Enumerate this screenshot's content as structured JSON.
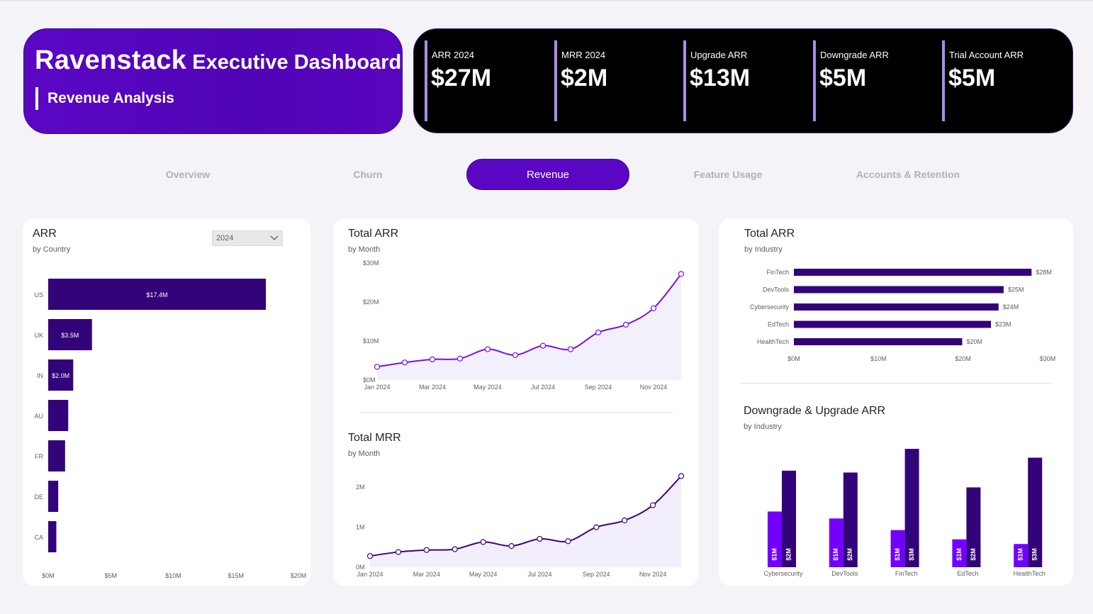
{
  "header": {
    "brand": "Ravenstack",
    "title_rest": "Executive Dashboard",
    "subtitle": "Revenue Analysis"
  },
  "kpis": [
    {
      "label": "ARR 2024",
      "value": "$27M"
    },
    {
      "label": "MRR 2024",
      "value": "$2M"
    },
    {
      "label": "Upgrade ARR",
      "value": "$13M"
    },
    {
      "label": "Downgrade ARR",
      "value": "$5M"
    },
    {
      "label": "Trial Account ARR",
      "value": "$5M"
    }
  ],
  "tabs": [
    {
      "label": "Overview",
      "active": false
    },
    {
      "label": "Churn",
      "active": false
    },
    {
      "label": "Revenue",
      "active": true
    },
    {
      "label": "Feature Usage",
      "active": false
    },
    {
      "label": "Accounts & Retention",
      "active": false
    }
  ],
  "filter": {
    "year": "2024",
    "icon": "chevron-down-icon"
  },
  "colors": {
    "accent": "#5a06c2",
    "bar_dark": "#33037a",
    "line_purple": "#7b10e8",
    "bar_bright": "#7200ff",
    "kpi_bar": "#a98de6"
  },
  "chart_data": [
    {
      "id": "arr_by_country",
      "type": "bar",
      "orientation": "horizontal",
      "title": "ARR",
      "subtitle": "by Country",
      "categories": [
        "US",
        "UK",
        "IN",
        "AU",
        "FR",
        "DE",
        "CA"
      ],
      "values": [
        17.4,
        3.5,
        2.0,
        1.6,
        1.35,
        0.8,
        0.65
      ],
      "data_labels": [
        "$17.4M",
        "$3.5M",
        "$2.0M",
        "",
        "",
        "",
        ""
      ],
      "x_ticks": [
        "$0M",
        "$5M",
        "$10M",
        "$15M",
        "$20M"
      ],
      "xlim": [
        0,
        20
      ]
    },
    {
      "id": "total_arr_by_month",
      "type": "area",
      "title": "Total ARR",
      "subtitle": "by Month",
      "x": [
        "Jan 2024",
        "Feb 2024",
        "Mar 2024",
        "Apr 2024",
        "May 2024",
        "Jun 2024",
        "Jul 2024",
        "Aug 2024",
        "Sep 2024",
        "Oct 2024",
        "Nov 2024",
        "Dec 2024"
      ],
      "x_tick_labels": [
        "Jan 2024",
        "Mar 2024",
        "May 2024",
        "Jul 2024",
        "Sep 2024",
        "Nov 2024"
      ],
      "values": [
        3.4,
        4.5,
        5.3,
        5.5,
        7.9,
        6.4,
        8.8,
        7.9,
        12.2,
        14.2,
        18.4,
        27.2
      ],
      "y_ticks": [
        "$0M",
        "$10M",
        "$20M",
        "$30M"
      ],
      "ylim": [
        0,
        30
      ]
    },
    {
      "id": "total_mrr_by_month",
      "type": "area",
      "title": "Total MRR",
      "subtitle": "by Month",
      "x": [
        "Jan 2024",
        "Feb 2024",
        "Mar 2024",
        "Apr 2024",
        "May 2024",
        "Jun 2024",
        "Jul 2024",
        "Aug 2024",
        "Sep 2024",
        "Oct 2024",
        "Nov 2024",
        "Dec 2024"
      ],
      "x_tick_labels": [
        "Jan 2024",
        "Mar 2024",
        "May 2024",
        "Jul 2024",
        "Sep 2024",
        "Nov 2024"
      ],
      "values": [
        0.28,
        0.38,
        0.43,
        0.45,
        0.63,
        0.53,
        0.71,
        0.65,
        1.0,
        1.17,
        1.55,
        2.28
      ],
      "y_ticks": [
        "0M",
        "1M",
        "2M"
      ],
      "ylim": [
        0,
        2.5
      ]
    },
    {
      "id": "total_arr_by_industry",
      "type": "bar",
      "orientation": "horizontal",
      "title": "Total ARR",
      "subtitle": "by Industry",
      "categories": [
        "FinTech",
        "DevTools",
        "Cybersecurity",
        "EdTech",
        "HealthTech"
      ],
      "values": [
        28.1,
        24.8,
        24.2,
        23.3,
        19.9
      ],
      "data_labels": [
        "$28M",
        "$25M",
        "$24M",
        "$23M",
        "$20M"
      ],
      "x_ticks": [
        "$0M",
        "$10M",
        "$20M",
        "$30M"
      ],
      "xlim": [
        0,
        30
      ]
    },
    {
      "id": "downgrade_upgrade_arr_by_industry",
      "type": "bar",
      "title": "Downgrade & Upgrade ARR",
      "subtitle": "by Industry",
      "categories": [
        "Cybersecurity",
        "DevTools",
        "FinTech",
        "EdTech",
        "HealthTech"
      ],
      "series": [
        {
          "values": [
            1.2,
            1.05,
            0.8,
            0.6,
            0.5
          ],
          "labels": [
            "$1M",
            "$1M",
            "$1M",
            "$1M",
            "$1M"
          ]
        },
        {
          "values": [
            2.08,
            2.04,
            2.55,
            1.72,
            2.36
          ],
          "labels": [
            "$2M",
            "$2M",
            "$3M",
            "$2M",
            "$3M"
          ]
        }
      ]
    }
  ]
}
